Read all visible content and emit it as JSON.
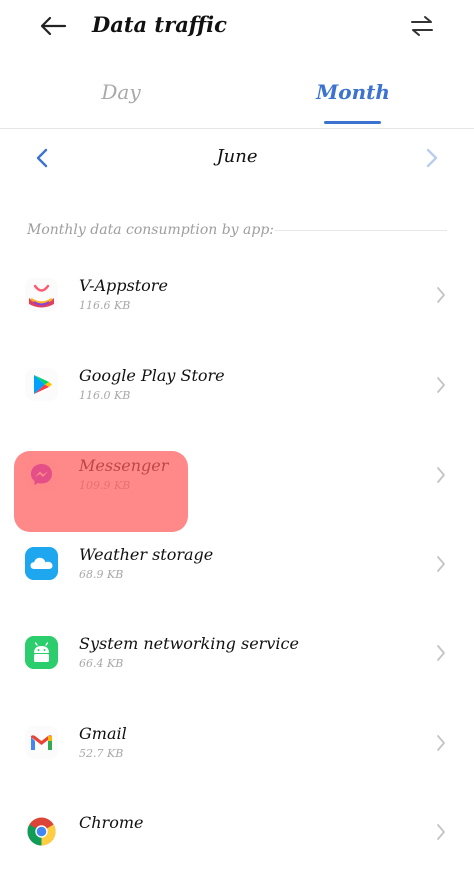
{
  "header": {
    "title": "Data traffic",
    "back_icon": "arrow-left-icon",
    "swap_icon": "swap-arrows-icon"
  },
  "tabs": [
    {
      "label": "Day",
      "selected": false
    },
    {
      "label": "Month",
      "selected": true
    }
  ],
  "month_nav": {
    "current": "June",
    "prev_icon": "chevron-left-icon",
    "next_icon": "chevron-right-icon"
  },
  "section": {
    "label": "Monthly data consumption by app:"
  },
  "apps": [
    {
      "name": "V-Appstore",
      "size": "116.6 KB",
      "icon": "v-appstore-icon"
    },
    {
      "name": "Google Play Store",
      "size": "116.0 KB",
      "icon": "google-play-icon"
    },
    {
      "name": "Messenger",
      "size": "109.9 KB",
      "icon": "messenger-icon"
    },
    {
      "name": "Weather storage",
      "size": "68.9 KB",
      "icon": "weather-icon"
    },
    {
      "name": "System networking service",
      "size": "66.4 KB",
      "icon": "android-icon"
    },
    {
      "name": "Gmail",
      "size": "52.7 KB",
      "icon": "gmail-icon"
    },
    {
      "name": "Chrome",
      "size": "",
      "icon": "chrome-icon"
    }
  ],
  "colors": {
    "accent": "#3d73d0",
    "highlight": "#ff5a5a"
  }
}
